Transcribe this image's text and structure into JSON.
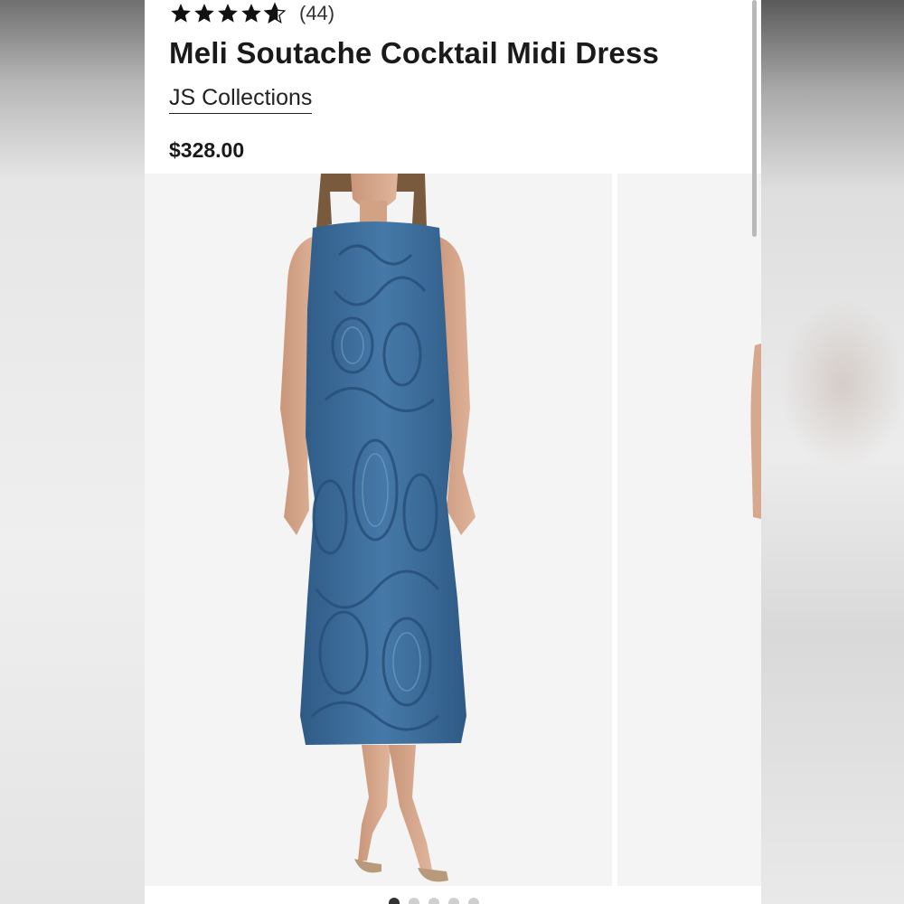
{
  "product": {
    "rating": 4.5,
    "rating_max": 5,
    "review_count": "(44)",
    "title": "Meli Soutache Cocktail Midi Dress",
    "brand": "JS Collections",
    "price": "$328.00"
  },
  "icons": {
    "star": "star-icon"
  },
  "colors": {
    "star": "#111111",
    "dress_blue": "#3f6e9c",
    "text": "#1a1a1a"
  },
  "gallery": {
    "image_count": 5,
    "active_index": 0
  }
}
